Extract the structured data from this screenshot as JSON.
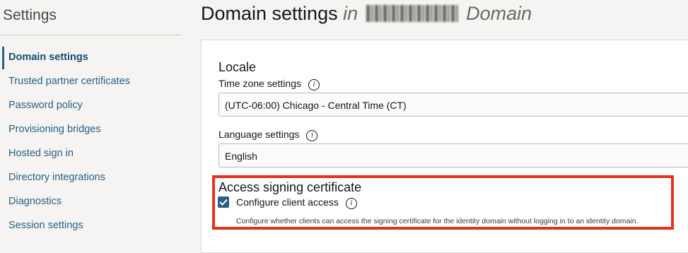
{
  "sidebar": {
    "title": "Settings",
    "items": [
      {
        "label": "Domain settings",
        "active": true
      },
      {
        "label": "Trusted partner certificates"
      },
      {
        "label": "Password policy"
      },
      {
        "label": "Provisioning bridges"
      },
      {
        "label": "Hosted sign in"
      },
      {
        "label": "Directory integrations"
      },
      {
        "label": "Diagnostics"
      },
      {
        "label": "Session settings"
      }
    ]
  },
  "header": {
    "title": "Domain settings",
    "in_word": "in",
    "domain_word": "Domain"
  },
  "locale": {
    "title": "Locale",
    "timezone_label": "Time zone settings",
    "timezone_value": "(UTC-06:00) Chicago - Central Time (CT)",
    "language_label": "Language settings",
    "language_value": "English"
  },
  "access_signing": {
    "title": "Access signing certificate",
    "checkbox_label": "Configure client access",
    "checked": true,
    "help_text": "Configure whether clients can access the signing certificate for the identity domain without logging in to an identity domain."
  },
  "colors": {
    "accent": "#2b5f83",
    "highlight_border": "#e3321e"
  },
  "icons": {
    "info": "info-icon",
    "check": "checkmark-icon"
  }
}
